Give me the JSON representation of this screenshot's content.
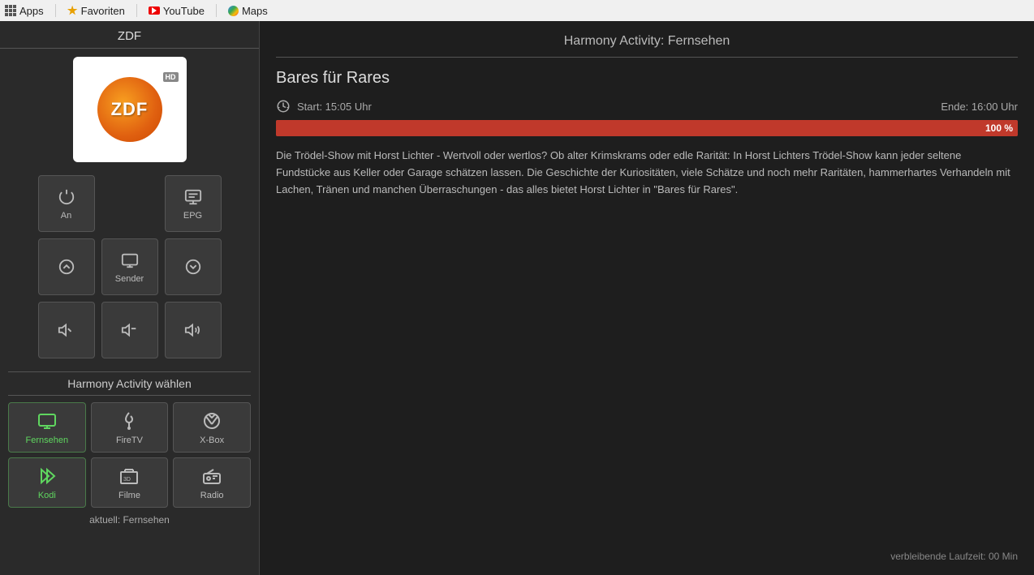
{
  "topbar": {
    "apps_label": "Apps",
    "favoriten_label": "Favoriten",
    "youtube_label": "YouTube",
    "maps_label": "Maps"
  },
  "left": {
    "channel_title": "ZDF",
    "controls": [
      {
        "id": "an",
        "label": "An",
        "icon": "power"
      },
      {
        "id": "empty1",
        "label": "",
        "icon": ""
      },
      {
        "id": "epg",
        "label": "EPG",
        "icon": "epg"
      },
      {
        "id": "up",
        "label": "",
        "icon": "up"
      },
      {
        "id": "sender",
        "label": "Sender",
        "icon": "tv"
      },
      {
        "id": "down",
        "label": "",
        "icon": "down"
      },
      {
        "id": "vol-down",
        "label": "",
        "icon": "vol-down"
      },
      {
        "id": "vol-mute",
        "label": "",
        "icon": "vol-mute"
      },
      {
        "id": "vol-up",
        "label": "",
        "icon": "vol-up"
      }
    ],
    "harmony_section_title": "Harmony Activity wählen",
    "activities": [
      {
        "id": "fernsehen",
        "label": "Fernsehen",
        "icon": "tv-act",
        "active": true
      },
      {
        "id": "firetv",
        "label": "FireTV",
        "icon": "fire",
        "active": false
      },
      {
        "id": "xbox",
        "label": "X-Box",
        "icon": "xbox",
        "active": false
      },
      {
        "id": "kodi",
        "label": "Kodi",
        "icon": "kodi",
        "active": true
      },
      {
        "id": "filme",
        "label": "Filme",
        "icon": "3d",
        "active": false
      },
      {
        "id": "radio",
        "label": "Radio",
        "icon": "radio",
        "active": false
      }
    ],
    "current_activity_label": "aktuell: Fernsehen"
  },
  "right": {
    "header_title": "Harmony Activity: Fernsehen",
    "program_title": "Bares für Rares",
    "start_label": "Start: 15:05 Uhr",
    "end_label": "Ende: 16:00 Uhr",
    "progress_percent": 100,
    "progress_label": "100 %",
    "description": "Die Trödel-Show mit Horst Lichter - Wertvoll oder wertlos? Ob alter Krimskrams oder edle Rarität: In Horst Lichters Trödel-Show kann jeder seltene Fundstücke aus Keller oder Garage schätzen lassen. Die Geschichte der Kuriositäten, viele Schätze und noch mehr Raritäten, hammerhartes Verhandeln mit Lachen, Tränen und manchen Überraschungen - das alles bietet Horst Lichter in \"Bares für Rares\".",
    "remaining_label": "verbleibende Laufzeit: 00 Min"
  }
}
